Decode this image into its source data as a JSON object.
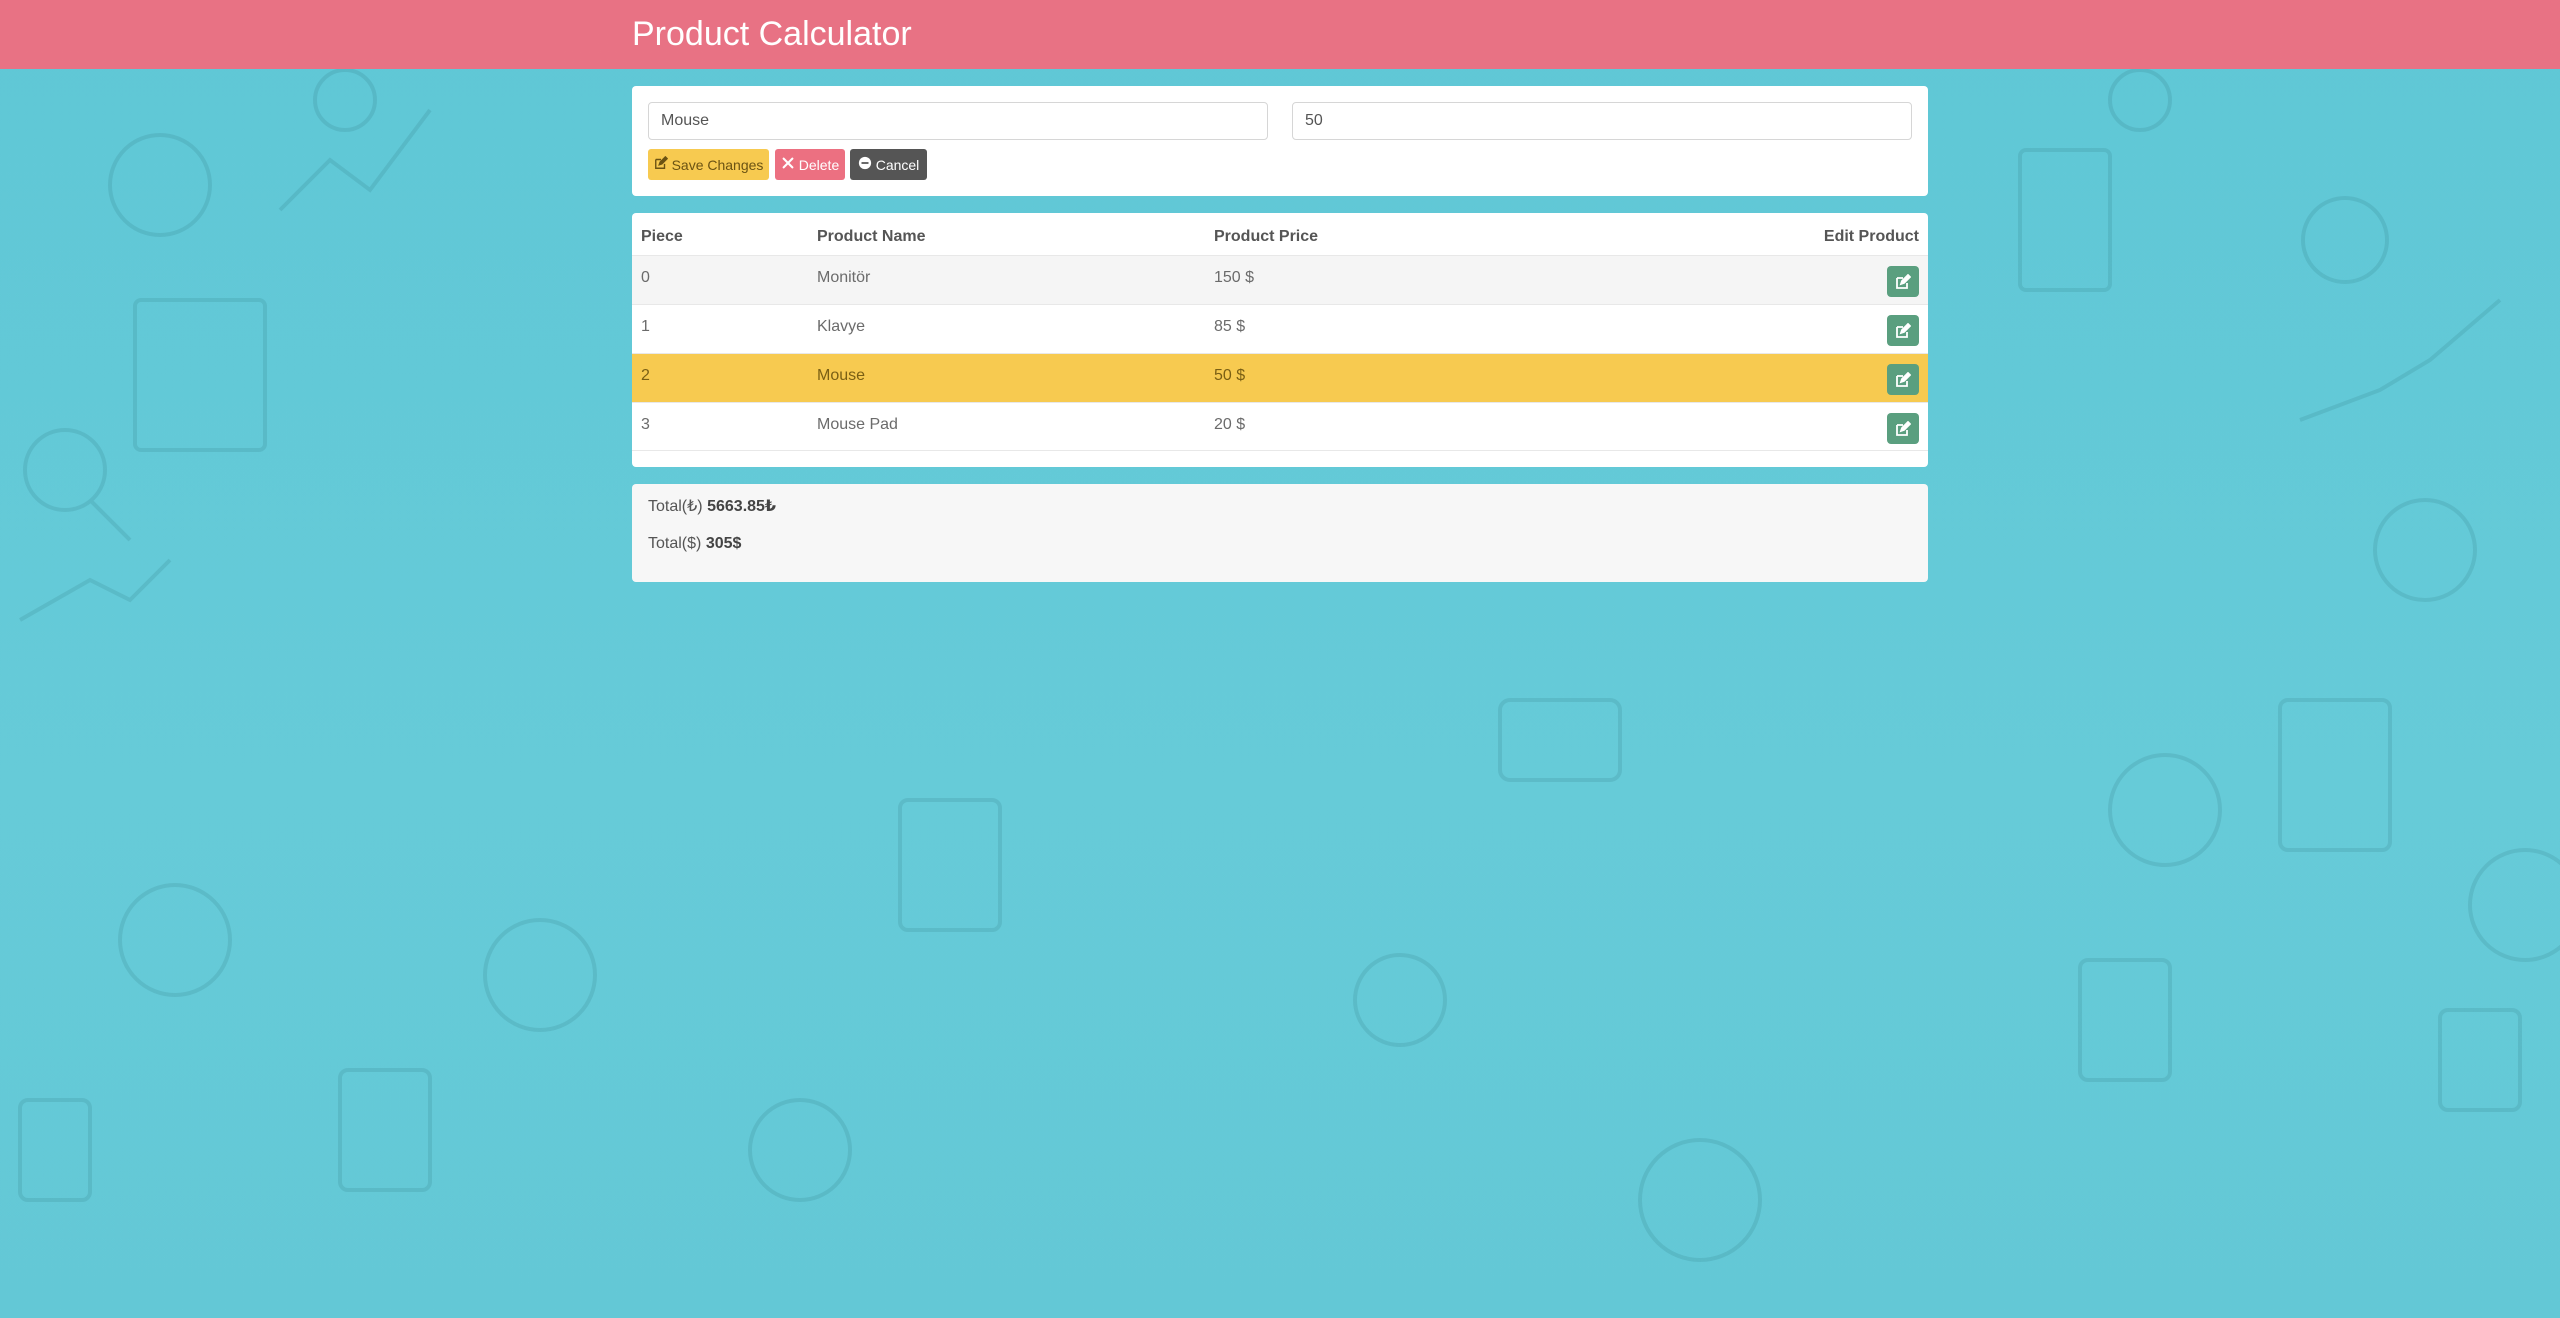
{
  "app": {
    "title": "Product Calculator"
  },
  "form": {
    "name_value": "Mouse",
    "price_value": "50",
    "save_label": "Save Changes",
    "delete_label": "Delete",
    "cancel_label": "Cancel"
  },
  "table": {
    "headers": [
      "Piece",
      "Product Name",
      "Product Price",
      "Edit Product"
    ],
    "rows": [
      {
        "piece": "0",
        "name": "Monitör",
        "price": "150 $"
      },
      {
        "piece": "1",
        "name": "Klavye",
        "price": "85 $"
      },
      {
        "piece": "2",
        "name": "Mouse",
        "price": "50 $"
      },
      {
        "piece": "3",
        "name": "Mouse Pad",
        "price": "20 $"
      }
    ],
    "selected_row": 2
  },
  "totals": {
    "try_label": "Total(₺)",
    "try_value": "5663.85₺",
    "usd_label": "Total($)",
    "usd_value": "305$"
  },
  "colors": {
    "navbar": "#ec7081",
    "background": "#63c8d6",
    "save": "#f7ca50",
    "delete": "#ec7081",
    "cancel": "#555555",
    "edit": "#5a9f7f",
    "selected_row": "#f7ca50"
  },
  "icons": {
    "save": "edit-icon",
    "delete": "close-icon",
    "cancel": "cancel-icon",
    "edit": "edit-icon"
  }
}
